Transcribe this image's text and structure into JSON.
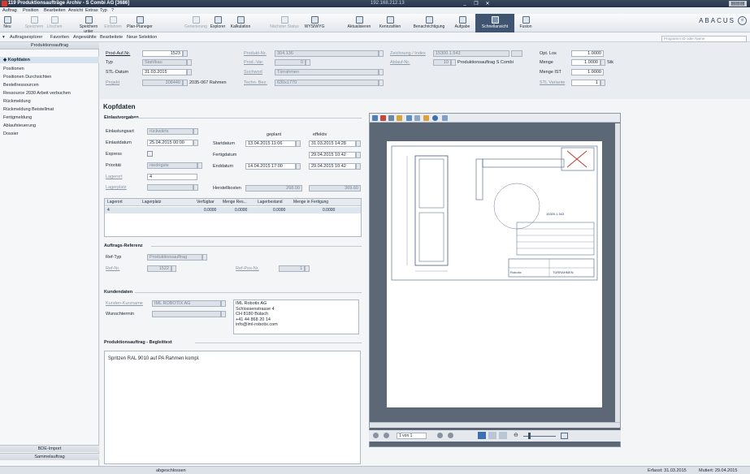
{
  "window": {
    "title": "119 Produktionsaufträge Archiv - S Combi AG [3686]",
    "remote_ip": "192.168.212.13",
    "min_label": "_",
    "max_label": "❐",
    "close_label": "✕",
    "corner_label": "▤▤▤"
  },
  "menu": [
    "Auftrag",
    "Position",
    "Bearbeiten",
    "Ansicht",
    "Extras",
    "Typ",
    "?"
  ],
  "ribbon": {
    "buttons": [
      {
        "label": "Neu",
        "icon": "new-icon",
        "disabled": false
      },
      {
        "label": "Speichern",
        "icon": "save-icon",
        "disabled": true
      },
      {
        "label": "Löschen",
        "icon": "delete-icon",
        "disabled": true
      },
      {
        "label": "Speichern unter",
        "icon": "save-as-icon",
        "disabled": false
      },
      {
        "label": "Einfahren",
        "icon": "copy-icon",
        "disabled": true
      },
      {
        "label": "Plan-Planeger",
        "icon": "planner-icon",
        "disabled": false
      },
      {
        "label": "Generierung",
        "icon": "generate-icon",
        "disabled": true
      },
      {
        "label": "Explorer",
        "icon": "explorer-icon",
        "disabled": false
      },
      {
        "label": "Kalkulation",
        "icon": "calc-icon",
        "disabled": false
      },
      {
        "label": "Nächster Status",
        "icon": "status-icon",
        "disabled": true
      },
      {
        "label": "WYSIWYG",
        "icon": "wysiwyg-icon",
        "disabled": false
      },
      {
        "label": "Aktualisieren",
        "icon": "refresh-icon",
        "disabled": false
      },
      {
        "label": "Kennzahlen",
        "icon": "kpi-icon",
        "disabled": false
      },
      {
        "label": "Benachrichtigung",
        "icon": "notify-icon",
        "disabled": false
      },
      {
        "label": "Aufgabe",
        "icon": "task-icon",
        "disabled": false
      },
      {
        "label": "Schnellansicht",
        "icon": "quickview-icon",
        "disabled": false,
        "active": true
      },
      {
        "label": "Fusion",
        "icon": "fusion-icon",
        "disabled": false
      }
    ],
    "brand": "ABACUS",
    "brand_badge": "vi",
    "search_placeholder": "Programm ID oder Name"
  },
  "subbar": [
    "Auftragsexplorer",
    "Favoriten",
    "Angewählte",
    "Bearbeitete",
    "Neue Selektion"
  ],
  "sidebar": {
    "title": "Produktionsauftrag",
    "items": [
      {
        "label": "Kopfdaten",
        "selected": true
      },
      {
        "label": "Positionen",
        "selected": false
      },
      {
        "label": "Positionen Durchsichten",
        "selected": false
      },
      {
        "label": "Bestellressourcen",
        "selected": false
      },
      {
        "label": "Ressource 2030 Arbeit verbuchen",
        "selected": false
      },
      {
        "label": "Rückmeldung",
        "selected": false
      },
      {
        "label": "Rückmeldung Beistellmat",
        "selected": false
      },
      {
        "label": "Fertigmeldung",
        "selected": false
      },
      {
        "label": "Ablaufsteuerung",
        "selected": false
      },
      {
        "label": "Dossier",
        "selected": false
      }
    ],
    "bottom_buttons": [
      "BDE-Import",
      "Sammelauftrag"
    ]
  },
  "header": {
    "prod_auf_label": "Prod-Auf.Nr.",
    "prod_auf_value": "1523",
    "typ_label": "Typ",
    "typ_value": "Stahlbau",
    "stl_datum_label": "STL-Datum",
    "stl_datum_value": "31.03.2015",
    "projekt_label": "Projekt",
    "projekt_value": "308440",
    "projekt_desc": "2035-067 Rahmen",
    "produkt_label": "Produkt-Nr.",
    "produkt_value": "304.136",
    "prod_var_label": "Prod.-Var.",
    "prod_var_value": "0",
    "suchwort_label": "Suchwort",
    "suchwort_value": "Türrahmen",
    "techn_bez_label": "Techn. Bez.",
    "techn_bez_value": "630x1770",
    "zeichnung_label": "Zeichnung / Index",
    "zeichnung_value": "15300.1.543",
    "ablauf_label": "Ablauf-Nr.",
    "ablauf_value": "10",
    "ablauf_desc": "Produktionsauftrag S Combi",
    "opt_los_label": "Opt. Los",
    "opt_los_value": "1.0000",
    "menge_label": "Menge",
    "menge_value": "1.0000",
    "menge_unit": "Stk",
    "menge_ist_label": "Menge IST",
    "menge_ist_value": "1.0000",
    "stl_variante_label": "STL Variante",
    "stl_variante_value": "1"
  },
  "main": {
    "title": "Kopfdaten",
    "einlast": {
      "section": "Einlastvorgaben",
      "einlastungsart_label": "Einlastungsart",
      "einlastungsart_value": "rückwärts",
      "einlastdatum_label": "Einlastdatum",
      "einlastdatum_value": "25.04.2015 00:00",
      "express_label": "Express",
      "prioritaet_label": "Priorität",
      "prioritaet_value": "niedrigste",
      "lagerort_label": "Lagerort",
      "lagerort_value": "4",
      "lagerplatz_label": "Lagerplatz",
      "col_geplant": "geplant",
      "col_effektiv": "effektiv",
      "startdatum_label": "Startdatum",
      "startdatum_geplant": "13.04.2015 11:06",
      "startdatum_effektiv": "31.03.2015 14:28",
      "fertigdatum_label": "Fertigdatum",
      "fertigdatum_effektiv": "29.04.2015 10:42",
      "enddatum_label": "Enddatum",
      "enddatum_geplant": "14.04.2015 17:00",
      "enddatum_effektiv": "29.04.2015 10:42",
      "herstellkosten_label": "Herstellkosten",
      "herstellkosten_geplant": "268.00",
      "herstellkosten_effektiv": "369.60"
    },
    "grid": {
      "headers": [
        "Lagerort",
        "Lagerplatz",
        "Verfügbar",
        "Menge Res...",
        "Lagerbestand",
        "Menge in Fertigung"
      ],
      "rows": [
        [
          "4",
          "",
          "0.0000",
          "0.0000",
          "0.0000",
          "0.0000"
        ]
      ]
    },
    "referenz": {
      "section": "Auftrags-Referenz",
      "ref_typ_label": "Ref-Typ",
      "ref_typ_value": "Produktionsauftrag",
      "ref_nr_label": "Ref-Nr.",
      "ref_nr_value": "1522",
      "ref_pos_label": "Ref-Pos-Nr.",
      "ref_pos_value": "1"
    },
    "kunde": {
      "section": "Kundendaten",
      "kurzname_label": "Kunden-Kurzname",
      "kurzname_value": "IML ROBOTIX AG",
      "wunschtermin_label": "Wunschtermin",
      "address": [
        "IML Robotix AG",
        "Schlossenstrasse 4",
        "CH 8180 Bülach",
        "+41 44 868 20 14",
        "info@iml-robotix.com"
      ]
    },
    "begleittext": {
      "section": "Produktionsauftrag - Begleittext",
      "text": "Spritzen RAL 9010 auf PA Rahmen kompl."
    }
  },
  "viewer": {
    "page_label": "1 von 1",
    "drawing_title": "TÜRRAHMEN",
    "drawing_no": "15300.1.543",
    "company": "Robotix"
  },
  "status": {
    "state": "abgeschlossen",
    "erfasst": "Erfasst: 31.03.2015",
    "mutiert": "Mutiert: 29.04.2015"
  }
}
